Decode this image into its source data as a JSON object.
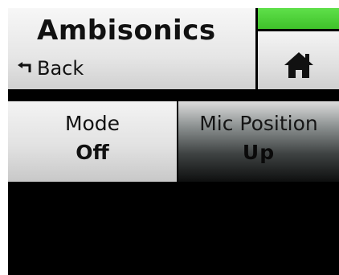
{
  "header": {
    "title": "Ambisonics",
    "back_label": "Back",
    "back_icon": "return-arrow-icon",
    "home_icon": "home-icon",
    "status_color": "#3fc22a"
  },
  "tabs": [
    {
      "label": "Mode",
      "value": "Off",
      "selected": true
    },
    {
      "label": "Mic Position",
      "value": "Up",
      "selected": false
    }
  ]
}
